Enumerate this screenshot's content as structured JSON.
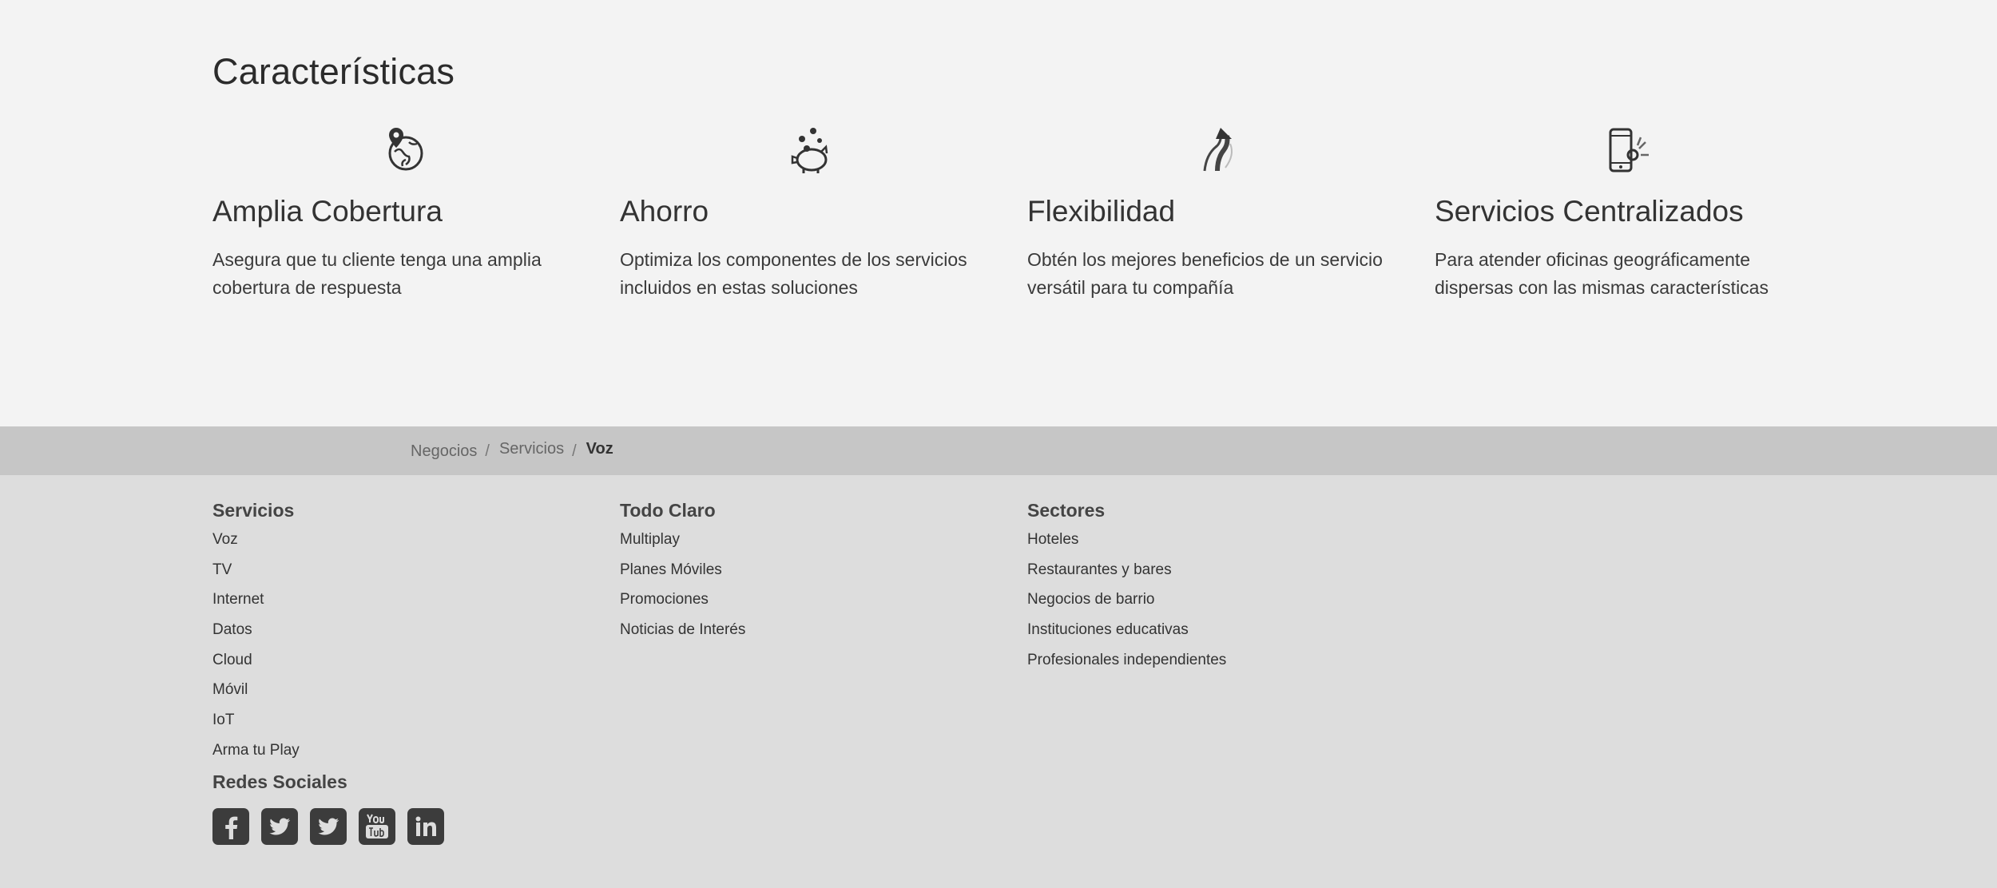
{
  "features": {
    "title": "Características",
    "items": [
      {
        "icon": "globe-location-icon",
        "title": "Amplia Cobertura",
        "desc": "Asegura que tu cliente tenga una amplia cobertura de respuesta"
      },
      {
        "icon": "piggy-bank-icon",
        "title": "Ahorro",
        "desc": "Optimiza los componentes de los servicios incluidos en estas soluciones"
      },
      {
        "icon": "arrow-up-icon",
        "title": "Flexibilidad",
        "desc": "Obtén los mejores beneficios de un servicio versátil para tu compañía"
      },
      {
        "icon": "mobile-settings-icon",
        "title": "Servicios Centralizados",
        "desc": "Para atender oficinas geográficamente dispersas con las mismas características"
      }
    ]
  },
  "breadcrumb": {
    "items": [
      "Negocios",
      "Servicios"
    ],
    "current": "Voz",
    "separator": "/"
  },
  "footer": {
    "columns": [
      {
        "heading": "Servicios",
        "links": [
          "Voz",
          "TV",
          "Internet",
          "Datos",
          "Cloud",
          "Móvil",
          "IoT",
          "Arma tu Play"
        ]
      },
      {
        "heading": "Todo Claro",
        "links": [
          "Multiplay",
          "Planes Móviles",
          "Promociones",
          "Noticias de Interés"
        ]
      },
      {
        "heading": "Sectores",
        "links": [
          "Hoteles",
          "Restaurantes y bares",
          "Negocios de barrio",
          "Instituciones educativas",
          "Profesionales independientes"
        ]
      }
    ],
    "social_heading": "Redes Sociales",
    "social": [
      "facebook-icon",
      "twitter-icon",
      "twitter-icon",
      "youtube-icon",
      "linkedin-icon"
    ]
  },
  "colors": {
    "features_bg": "#f3f3f3",
    "breadcrumb_bg": "#c6c6c6",
    "footer_bg": "#dddddd",
    "icon_dark": "#3c3c3c"
  }
}
